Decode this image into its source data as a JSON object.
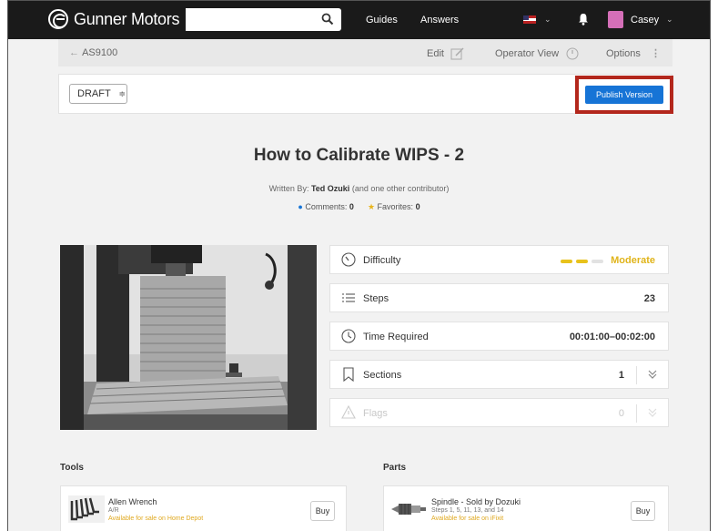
{
  "brand": {
    "name": "Gunner Motors"
  },
  "search": {
    "value": "",
    "placeholder": ""
  },
  "nav": {
    "guides": "Guides",
    "answers": "Answers",
    "user": "Casey"
  },
  "subbar": {
    "back": "AS9100",
    "edit": "Edit",
    "operator_view": "Operator View",
    "options": "Options"
  },
  "toolbar": {
    "status": "DRAFT",
    "publish": "Publish Version"
  },
  "guide": {
    "title": "How to Calibrate WIPS - 2",
    "written_by_label": "Written By:",
    "author": "Ted Ozuki",
    "contributors": "(and one other contributor)",
    "comments_label": "Comments:",
    "comments": "0",
    "favorites_label": "Favorites:",
    "favorites": "0"
  },
  "info": {
    "difficulty_label": "Difficulty",
    "difficulty_value": "Moderate",
    "difficulty_level": 2,
    "difficulty_max": 3,
    "steps_label": "Steps",
    "steps_value": "23",
    "time_label": "Time Required",
    "time_value": "00:01:00–00:02:00",
    "sections_label": "Sections",
    "sections_value": "1",
    "flags_label": "Flags",
    "flags_value": "0"
  },
  "tools": {
    "title": "Tools",
    "items": [
      {
        "name": "Allen Wrench",
        "sub": "A/R",
        "sale": "Available for sale on Home Depot",
        "buy": "Buy"
      }
    ]
  },
  "parts": {
    "title": "Parts",
    "items": [
      {
        "name": "Spindle - Sold by Dozuki",
        "sub": "Steps 1, 5, 11, 13, and 14",
        "sale": "Available for sale on iFixit",
        "buy": "Buy"
      }
    ]
  },
  "colors": {
    "accent": "#1674d6",
    "highlight": "#b3271c",
    "difficulty": "#e8c21c",
    "nav": "#1a1a1a"
  }
}
